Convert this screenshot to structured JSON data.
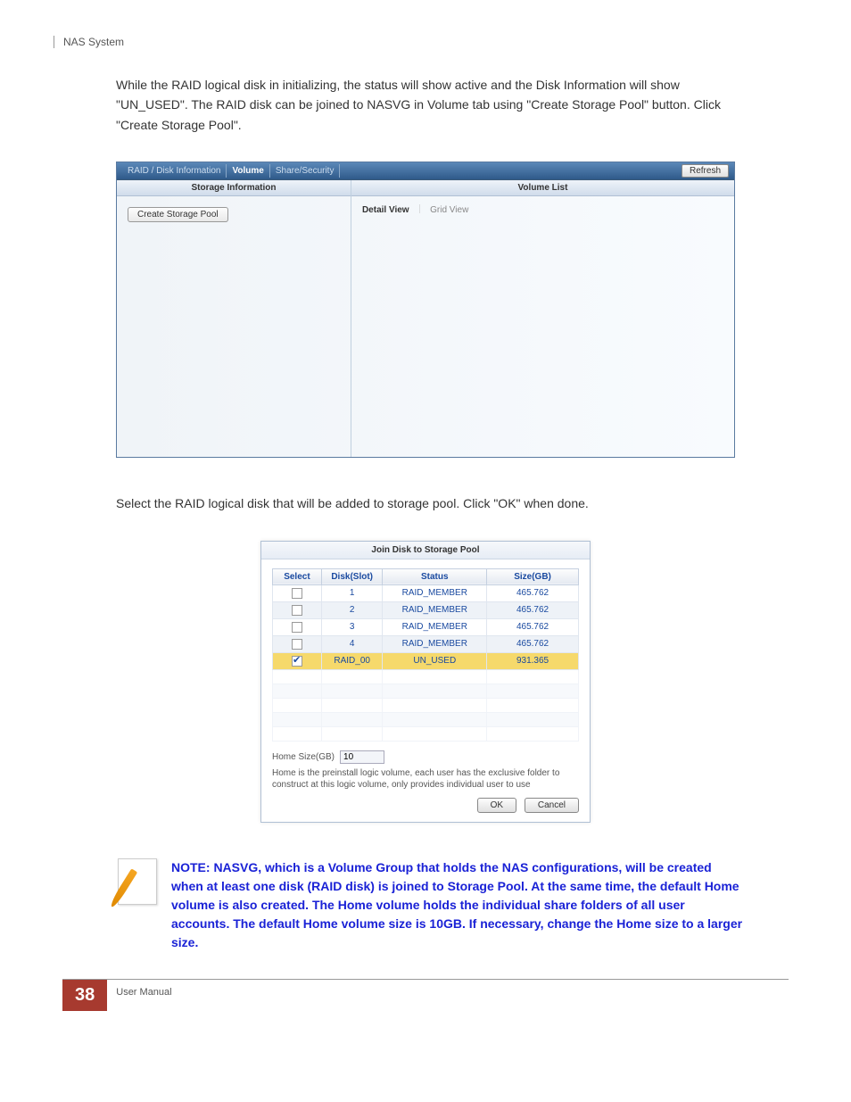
{
  "header": {
    "title": "NAS System"
  },
  "para1": "While the RAID logical disk in initializing, the status will show active and the Disk Information will show \"UN_USED\". The RAID disk can be joined to NASVG in Volume tab using \"Create Storage Pool\" button. Click \"Create Storage Pool\".",
  "panel1": {
    "tabs": [
      "RAID / Disk Information",
      "Volume",
      "Share/Security"
    ],
    "refresh": "Refresh",
    "left_header": "Storage Information",
    "create_btn": "Create Storage Pool",
    "right_header": "Volume List",
    "detail_view": "Detail View",
    "grid_view": "Grid View"
  },
  "para2": "Select the RAID logical disk that will be added to storage pool. Click \"OK\" when done.",
  "dialog": {
    "title": "Join Disk to Storage Pool",
    "col_select": "Select",
    "col_disk": "Disk(Slot)",
    "col_status": "Status",
    "col_size": "Size(GB)",
    "rows": [
      {
        "checked": false,
        "disk": "1",
        "status": "RAID_MEMBER",
        "size": "465.762"
      },
      {
        "checked": false,
        "disk": "2",
        "status": "RAID_MEMBER",
        "size": "465.762"
      },
      {
        "checked": false,
        "disk": "3",
        "status": "RAID_MEMBER",
        "size": "465.762"
      },
      {
        "checked": false,
        "disk": "4",
        "status": "RAID_MEMBER",
        "size": "465.762"
      },
      {
        "checked": true,
        "disk": "RAID_00",
        "status": "UN_USED",
        "size": "931.365"
      }
    ],
    "home_label": "Home Size(GB)",
    "home_value": "10",
    "home_note": "Home is the preinstall logic volume, each user has the exclusive folder to construct at this logic volume, only provides individual user to use",
    "ok": "OK",
    "cancel": "Cancel"
  },
  "note": "NOTE: NASVG, which is a Volume Group that holds the NAS configurations, will be created when at least one disk (RAID disk) is joined to Storage Pool. At the same time, the default Home volume is also created. The Home volume holds the individual share folders of all user accounts. The default Home volume size is 10GB. If necessary, change the Home size to a larger size.",
  "footer": {
    "page": "38",
    "manual": "User Manual"
  }
}
